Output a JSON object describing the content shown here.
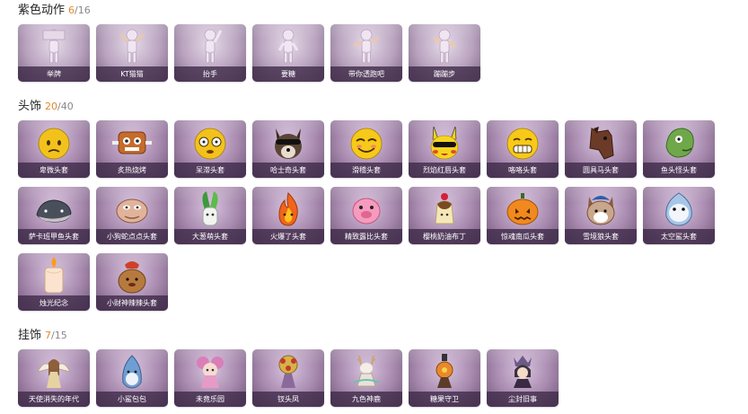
{
  "sections": [
    {
      "title": "紫色动作",
      "owned": "6",
      "total": "/16",
      "items": [
        {
          "label": "举牌",
          "icon": "figure-sign-icon"
        },
        {
          "label": "KT猫猫",
          "icon": "figure-dance-icon"
        },
        {
          "label": "抬手",
          "icon": "figure-raise-hand-icon"
        },
        {
          "label": "要糖",
          "icon": "figure-beg-icon"
        },
        {
          "label": "带你透跑吧",
          "icon": "figure-run-icon"
        },
        {
          "label": "蹦蹦步",
          "icon": "figure-hop-icon"
        }
      ]
    },
    {
      "title": "头饰",
      "owned": "20",
      "total": "/40",
      "items": [
        {
          "label": "卑微头套",
          "icon": "worried-face-icon"
        },
        {
          "label": "炙热烧烤",
          "icon": "barbecue-icon"
        },
        {
          "label": "呆滞头套",
          "icon": "dazed-face-icon"
        },
        {
          "label": "哈士奇头套",
          "icon": "husky-icon"
        },
        {
          "label": "滑稽头套",
          "icon": "funny-face-icon"
        },
        {
          "label": "烈焰红唇头套",
          "icon": "pikachu-icon"
        },
        {
          "label": "咯咯头套",
          "icon": "grin-face-icon"
        },
        {
          "label": "圆具马头套",
          "icon": "horse-head-icon"
        },
        {
          "label": "鱼头怪头套",
          "icon": "fish-head-icon"
        },
        {
          "label": "萨卡班甲鱼头套",
          "icon": "whale-icon"
        },
        {
          "label": "小狗蛇点点头套",
          "icon": "snake-head-icon"
        },
        {
          "label": "大葱萌头套",
          "icon": "leek-icon"
        },
        {
          "label": "火爆了头套",
          "icon": "fire-icon"
        },
        {
          "label": "精致露比头套",
          "icon": "pink-pig-icon"
        },
        {
          "label": "樱桃奶油布丁",
          "icon": "pudding-icon"
        },
        {
          "label": "惊魂南瓜头套",
          "icon": "pumpkin-icon"
        },
        {
          "label": "雪境狼头套",
          "icon": "snow-wolf-icon"
        },
        {
          "label": "太空鲨头套",
          "icon": "space-shark-icon"
        },
        {
          "label": "烛光纪念",
          "icon": "candle-icon"
        },
        {
          "label": "小财神辣辣头套",
          "icon": "money-bag-icon"
        }
      ]
    },
    {
      "title": "挂饰",
      "owned": "7",
      "total": "/15",
      "items": [
        {
          "label": "天使消失的年代",
          "icon": "angel-icon"
        },
        {
          "label": "小鲨包包",
          "icon": "shark-bag-icon"
        },
        {
          "label": "未竟乐园",
          "icon": "fairy-doll-icon"
        },
        {
          "label": "钗头凤",
          "icon": "phoenix-hairpin-icon"
        },
        {
          "label": "九色神鹿",
          "icon": "deer-icon"
        },
        {
          "label": "糖果守卫",
          "icon": "candy-guard-icon"
        },
        {
          "label": "尘封旧事",
          "icon": "old-story-icon"
        }
      ]
    }
  ],
  "colors": {
    "accent_count": "#e0892b",
    "card_top": "#d9c4df",
    "card_bottom": "#6f5677",
    "label_bg": "#3c2846"
  }
}
